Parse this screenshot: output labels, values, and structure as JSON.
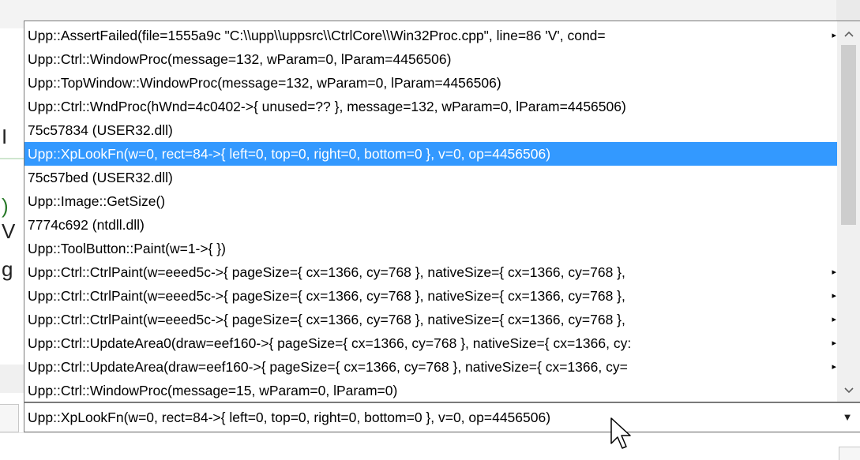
{
  "dropdown": {
    "items": [
      {
        "text": "Upp::AssertFailed(file=1555a9c \"C:\\\\upp\\\\uppsrc\\\\CtrlCore\\\\Win32Proc.cpp\", line=86 'V', cond=",
        "more": "▸"
      },
      {
        "text": "Upp::Ctrl::WindowProc(message=132, wParam=0, lParam=4456506)",
        "more": ""
      },
      {
        "text": "Upp::TopWindow::WindowProc(message=132, wParam=0, lParam=4456506)",
        "more": ""
      },
      {
        "text": "Upp::Ctrl::WndProc(hWnd=4c0402->{ unused=?? }, message=132, wParam=0, lParam=4456506)",
        "more": ""
      },
      {
        "text": "75c57834 (USER32.dll)",
        "more": ""
      },
      {
        "text": "Upp::XpLookFn(w=0, rect=84->{ left=0, top=0, right=0, bottom=0 }, v=0, op=4456506)",
        "more": "",
        "selected": true
      },
      {
        "text": "75c57bed (USER32.dll)",
        "more": ""
      },
      {
        "text": "Upp::Image::GetSize()",
        "more": ""
      },
      {
        "text": "7774c692 (ntdll.dll)",
        "more": ""
      },
      {
        "text": "Upp::ToolButton::Paint(w=1->{ })",
        "more": ""
      },
      {
        "text": "Upp::Ctrl::CtrlPaint(w=eeed5c->{ pageSize={ cx=1366, cy=768 }, nativeSize={ cx=1366, cy=768 },",
        "more": "▸"
      },
      {
        "text": "Upp::Ctrl::CtrlPaint(w=eeed5c->{ pageSize={ cx=1366, cy=768 }, nativeSize={ cx=1366, cy=768 },",
        "more": "▸"
      },
      {
        "text": "Upp::Ctrl::CtrlPaint(w=eeed5c->{ pageSize={ cx=1366, cy=768 }, nativeSize={ cx=1366, cy=768 },",
        "more": "▸"
      },
      {
        "text": "Upp::Ctrl::UpdateArea0(draw=eef160->{ pageSize={ cx=1366, cy=768 }, nativeSize={ cx=1366, cy:",
        "more": "▸"
      },
      {
        "text": "Upp::Ctrl::UpdateArea(draw=eef160->{ pageSize={ cx=1366, cy=768 }, nativeSize={ cx=1366, cy=",
        "more": "▸"
      },
      {
        "text": "Upp::Ctrl::WindowProc(message=15, wParam=0, lParam=0)",
        "more": ""
      }
    ],
    "scroll_up_icon": "chevron-up",
    "scroll_down_icon": "chevron-down"
  },
  "combo": {
    "value": "Upp::XpLookFn(w=0, rect=84->{ left=0, top=0, right=0, bottom=0 }, v=0, op=4456506)",
    "drop_icon": "▼"
  },
  "background": {
    "fragment_1": "I",
    "fragment_2": ")",
    "fragment_3": "V",
    "fragment_4": "g"
  },
  "colors": {
    "selection": "#3399ff",
    "border": "#7a7a7a"
  }
}
